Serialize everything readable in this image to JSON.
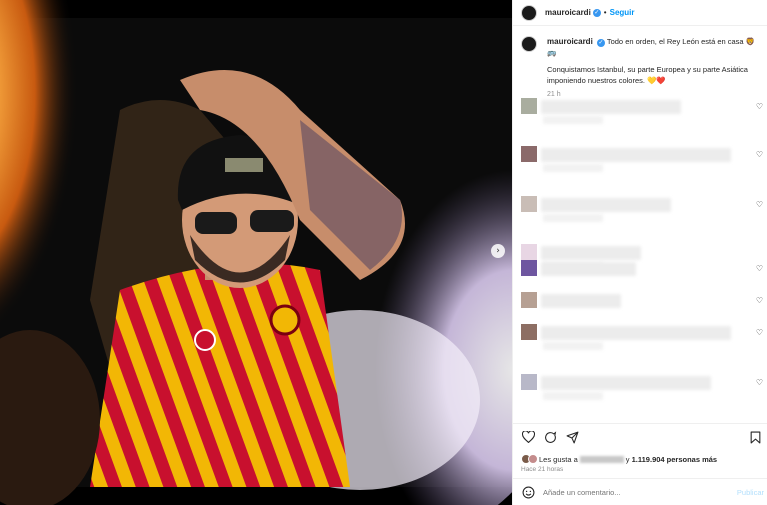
{
  "post": {
    "username": "mauroicardi",
    "follow_label": "Seguir",
    "separator": "•",
    "caption_line1": "Todo en orden, el Rey León está en casa 🦁🚌",
    "caption_line2": "Conquistamos Istanbul, su parte Europea y su parte Asiática imponiendo nuestros colores. 💛❤️",
    "caption_time": "21 h",
    "next_arrow": "›"
  },
  "comments": {
    "count_visible": 8,
    "heart_glyph": "♡"
  },
  "likes": {
    "prefix": "Les gusta a",
    "middle": "y",
    "count_text": "1.119.904 personas más"
  },
  "time_ago": "Hace 21 horas",
  "comment_box": {
    "placeholder": "Añade un comentario...",
    "publish_label": "Publicar"
  },
  "colors": {
    "accent": "#0095f6",
    "verified": "#3897f0",
    "muted": "#8e8e8e"
  }
}
